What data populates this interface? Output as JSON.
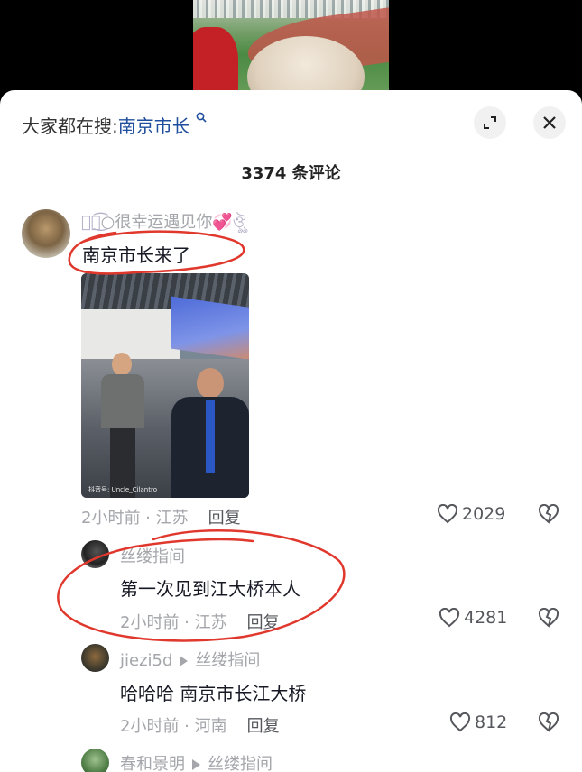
{
  "search": {
    "prefix": "大家都在搜:",
    "keyword": "南京市长",
    "search_icon": "search-icon"
  },
  "controls": {
    "expand_icon": "expand-icon",
    "close_icon": "close-icon"
  },
  "comments_count": "3374 条评论",
  "comments": [
    {
      "username": "○很幸运遇见你",
      "username_deco_left": "ঔৣ͜͡",
      "username_deco_right": "ঔৣ",
      "text": "南京市长来了",
      "has_photo": true,
      "photo_watermark": "抖音号: Uncle_Cilantro",
      "time_location": "2小时前 · 江苏",
      "reply_label": "回复",
      "likes": "2029"
    },
    {
      "username": "丝缕指间",
      "text": "第一次见到江大桥本人",
      "time_location": "2小时前 · 江苏",
      "reply_label": "回复",
      "likes": "4281"
    },
    {
      "username": "jiezi5d",
      "reply_to": "丝缕指间",
      "text": "哈哈哈  南京市长江大桥",
      "time_location": "2小时前 · 河南",
      "reply_label": "回复",
      "likes": "812"
    },
    {
      "username": "春和景明",
      "reply_to": "丝缕指间"
    }
  ],
  "colors": {
    "keyword": "#1f4e9c",
    "annotation": "#e0382d",
    "muted": "#a4a6ab"
  }
}
